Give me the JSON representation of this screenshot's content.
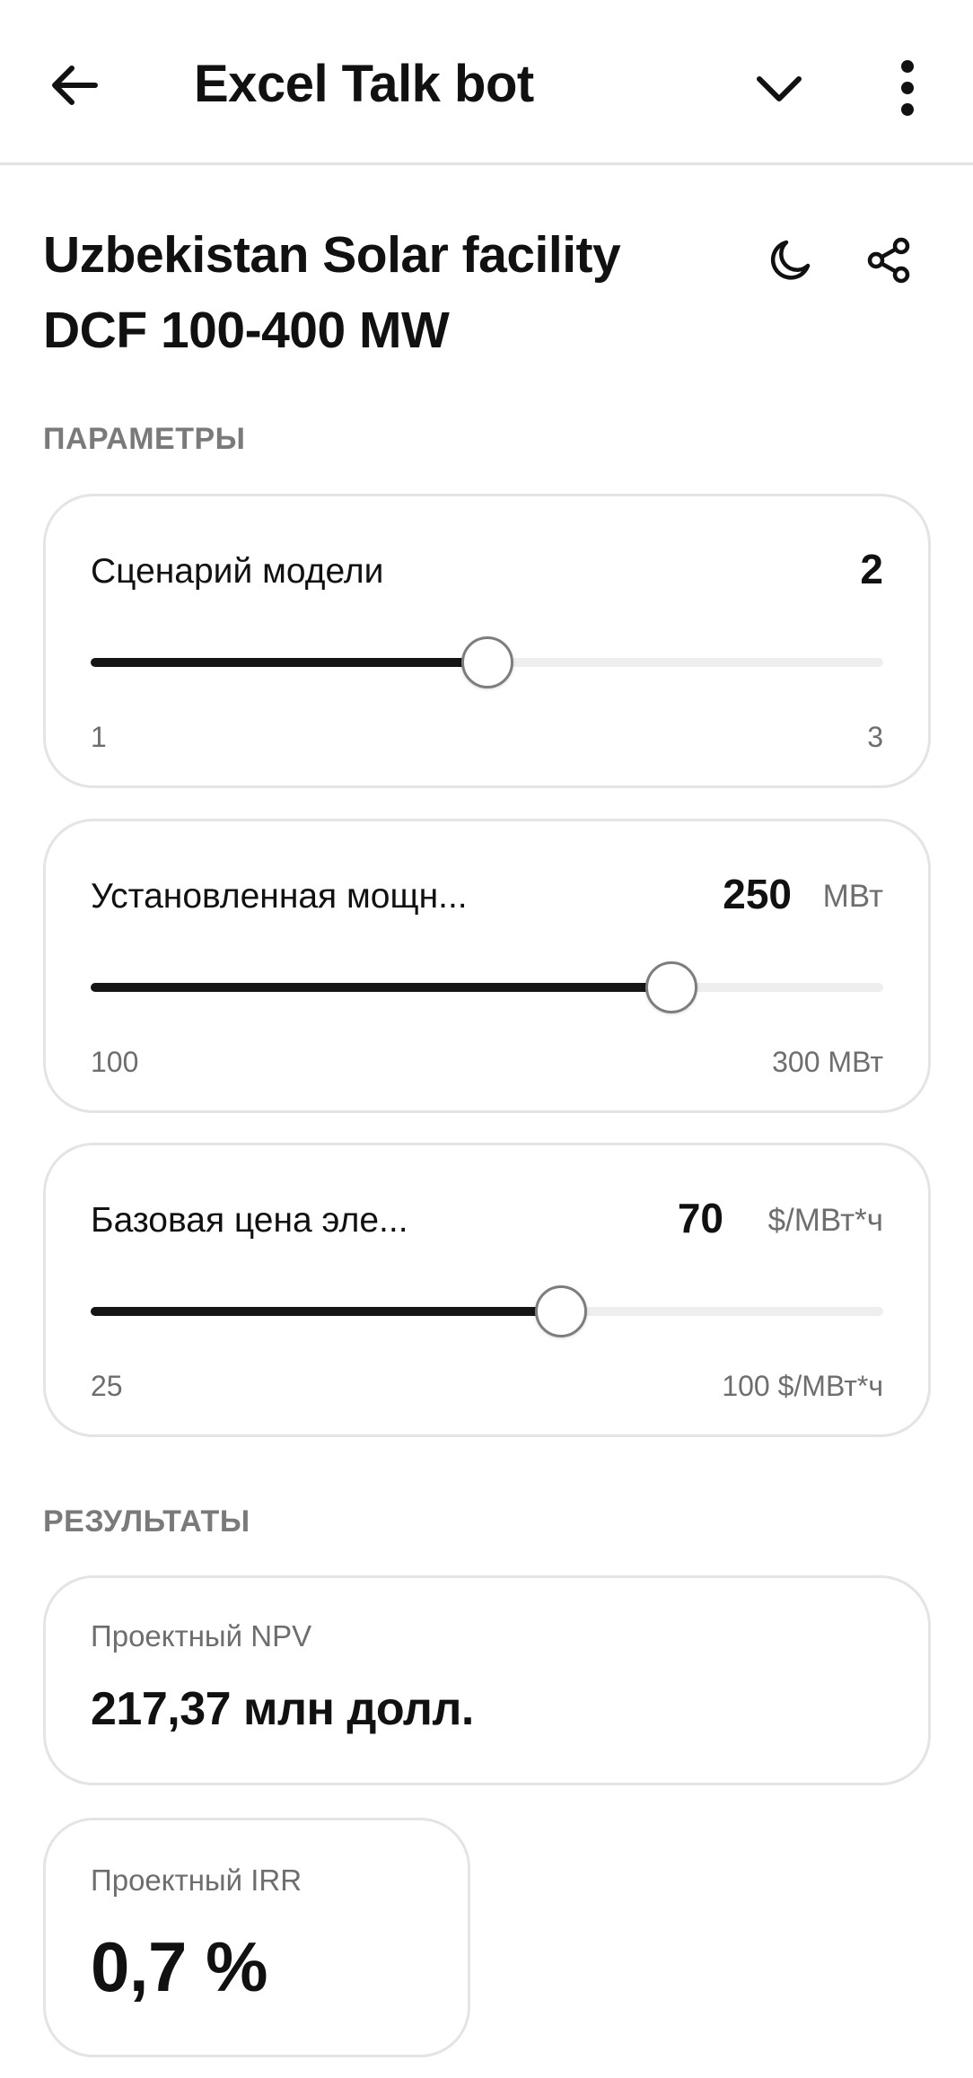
{
  "header": {
    "title": "Excel Talk bot",
    "back_icon": "arrow-left-icon",
    "collapse_icon": "chevron-down-icon",
    "more_icon": "more-vertical-icon"
  },
  "page": {
    "title": "Uzbekistan Solar facility DCF 100-400 MW",
    "theme_icon": "moon-icon",
    "share_icon": "share-icon"
  },
  "parameters": {
    "section_label": "ПАРАМЕТРЫ",
    "sliders": [
      {
        "label": "Сценарий модели",
        "value": "2",
        "unit": "",
        "min_label": "1",
        "max_label": "3",
        "fraction": 0.5
      },
      {
        "label": "Установленная мощн...",
        "value": "250",
        "unit": "МВт",
        "min_label": "100",
        "max_label": "300 МВт",
        "fraction": 0.733
      },
      {
        "label": "Базовая цена эле...",
        "value": "70",
        "unit": "$/МВт*ч",
        "min_label": "25",
        "max_label": "100 $/МВт*ч",
        "fraction": 0.593
      }
    ]
  },
  "results": {
    "section_label": "РЕЗУЛЬТАТЫ",
    "npv": {
      "label": "Проектный NPV",
      "value": "217,37 млн долл."
    },
    "irr": {
      "label": "Проектный IRR",
      "value": "0,7 %"
    }
  },
  "colors": {
    "track_fill": "#151515",
    "track_empty": "#eeeeee",
    "card_border": "#e4e4e4",
    "muted_text": "#7a7a7a"
  }
}
